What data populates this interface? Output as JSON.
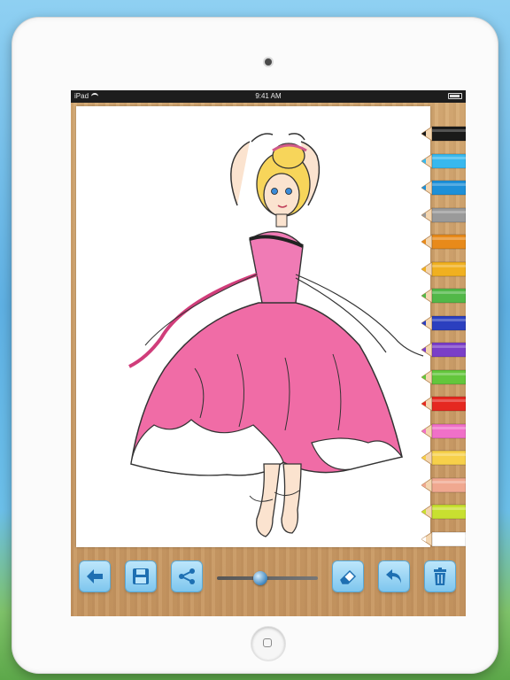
{
  "statusbar": {
    "device": "iPad",
    "time": "9:41 AM"
  },
  "drawing": {
    "subject-icon": "ballerina-coloring-page",
    "dress_color": "#f06ca6"
  },
  "palette": {
    "colors": [
      "#1a1a1a",
      "#38b8ee",
      "#1e90d8",
      "#9a9a9a",
      "#e88a1a",
      "#f0b020",
      "#52b848",
      "#2b3fbf",
      "#7a3fc8",
      "#63c63c",
      "#e52820",
      "#f070c8",
      "#f7d04a",
      "#f0a890",
      "#c8e030",
      "#ffffff"
    ]
  },
  "toolbar": {
    "slider_value": 0.42,
    "buttons": [
      "back-arrow-icon",
      "save-icon",
      "share-icon",
      "eraser-icon",
      "undo-icon",
      "trash-icon"
    ]
  }
}
